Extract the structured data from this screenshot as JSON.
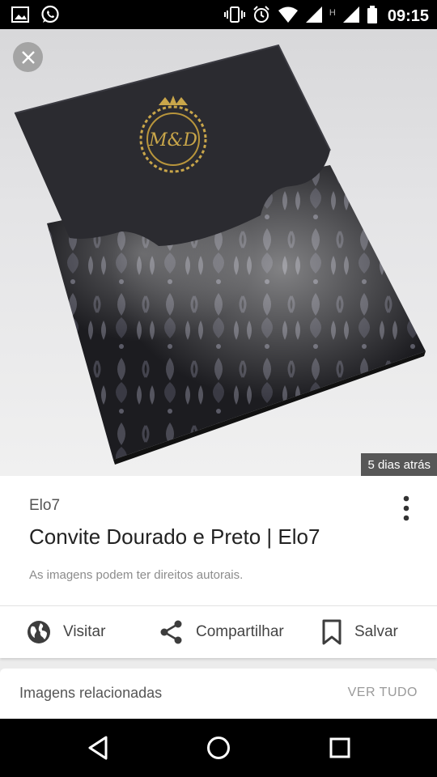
{
  "status_bar": {
    "time": "09:15",
    "network_label": "H",
    "icons": [
      "image-notification-icon",
      "whatsapp-icon",
      "vibrate-icon",
      "alarm-icon",
      "wifi-icon",
      "signal-icon",
      "signal-icon-2",
      "battery-icon"
    ]
  },
  "hero": {
    "monogram": "M&D",
    "time_ago": "5 dias atrás",
    "close_icon": "close-icon"
  },
  "pin": {
    "source": "Elo7",
    "title": "Convite Dourado e Preto | Elo7",
    "copyright_note": "As imagens podem ter direitos autorais.",
    "more_icon": "more-vertical-icon"
  },
  "actions": {
    "visit": {
      "label": "Visitar",
      "icon": "globe-icon"
    },
    "share": {
      "label": "Compartilhar",
      "icon": "share-icon"
    },
    "save": {
      "label": "Salvar",
      "icon": "bookmark-icon"
    }
  },
  "related": {
    "title": "Imagens relacionadas",
    "see_all": "VER TUDO"
  },
  "nav_bar": {
    "icons": [
      "back-icon",
      "home-icon",
      "recents-icon"
    ]
  },
  "colors": {
    "card_black": "#232326",
    "gold": "#c9a64a",
    "status_bar": "#000000",
    "background": "#ececec"
  }
}
